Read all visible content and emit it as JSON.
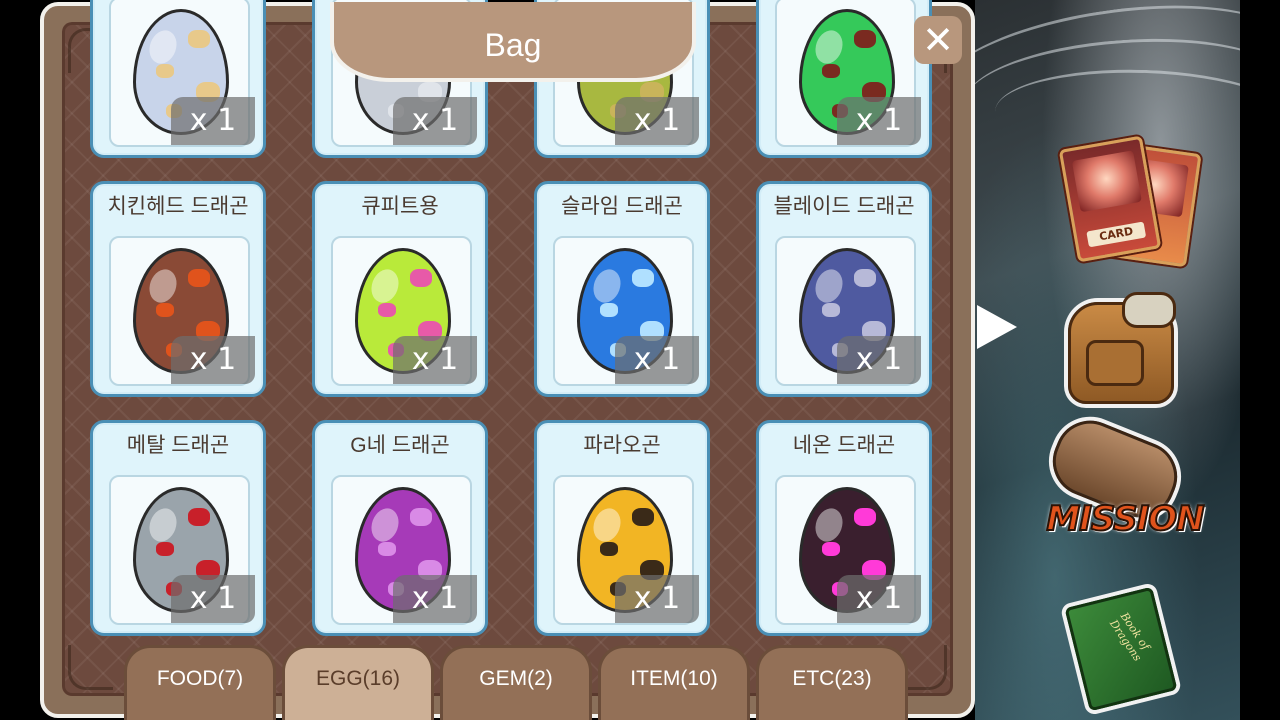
{
  "bag": {
    "title": "Bag",
    "close_label": "✕"
  },
  "items": [
    {
      "name": "",
      "qty": "x 1",
      "egg_color": "#c8d4ea",
      "spot_color": "#e8c98a"
    },
    {
      "name": "",
      "qty": "x 1",
      "egg_color": "#c9cfd8",
      "spot_color": "#e0e4ea"
    },
    {
      "name": "",
      "qty": "x 1",
      "egg_color": "#a8b840",
      "spot_color": "#c9b45a"
    },
    {
      "name": "",
      "qty": "x 1",
      "egg_color": "#35c95a",
      "spot_color": "#7a2a20"
    },
    {
      "name": "치킨헤드 드래곤",
      "qty": "x 1",
      "egg_color": "#8a4a36",
      "spot_color": "#e0531c"
    },
    {
      "name": "큐피트용",
      "qty": "x 1",
      "egg_color": "#b9ea3a",
      "spot_color": "#e75aa8"
    },
    {
      "name": "슬라임 드래곤",
      "qty": "x 1",
      "egg_color": "#2a7ae0",
      "spot_color": "#b0e0ff"
    },
    {
      "name": "블레이드 드래곤",
      "qty": "x 1",
      "egg_color": "#4f5aa0",
      "spot_color": "#b7b9d8"
    },
    {
      "name": "메탈 드래곤",
      "qty": "x 1",
      "egg_color": "#9aa4ab",
      "spot_color": "#c8202a"
    },
    {
      "name": "G네 드래곤",
      "qty": "x 1",
      "egg_color": "#a63ab8",
      "spot_color": "#d98ae6"
    },
    {
      "name": "파라오곤",
      "qty": "x 1",
      "egg_color": "#f2b524",
      "spot_color": "#3a2a18"
    },
    {
      "name": "네온 드래곤",
      "qty": "x 1",
      "egg_color": "#3a1f2e",
      "spot_color": "#ff3ad8"
    }
  ],
  "tabs": [
    {
      "label": "FOOD(7)",
      "active": false
    },
    {
      "label": "EGG(16)",
      "active": true
    },
    {
      "label": "GEM(2)",
      "active": false
    },
    {
      "label": "ITEM(10)",
      "active": false
    },
    {
      "label": "ETC(23)",
      "active": false
    }
  ],
  "side_menu": {
    "card_label": "CARD",
    "mission_label": "MISSION",
    "book_label": "Book of Dragons"
  }
}
